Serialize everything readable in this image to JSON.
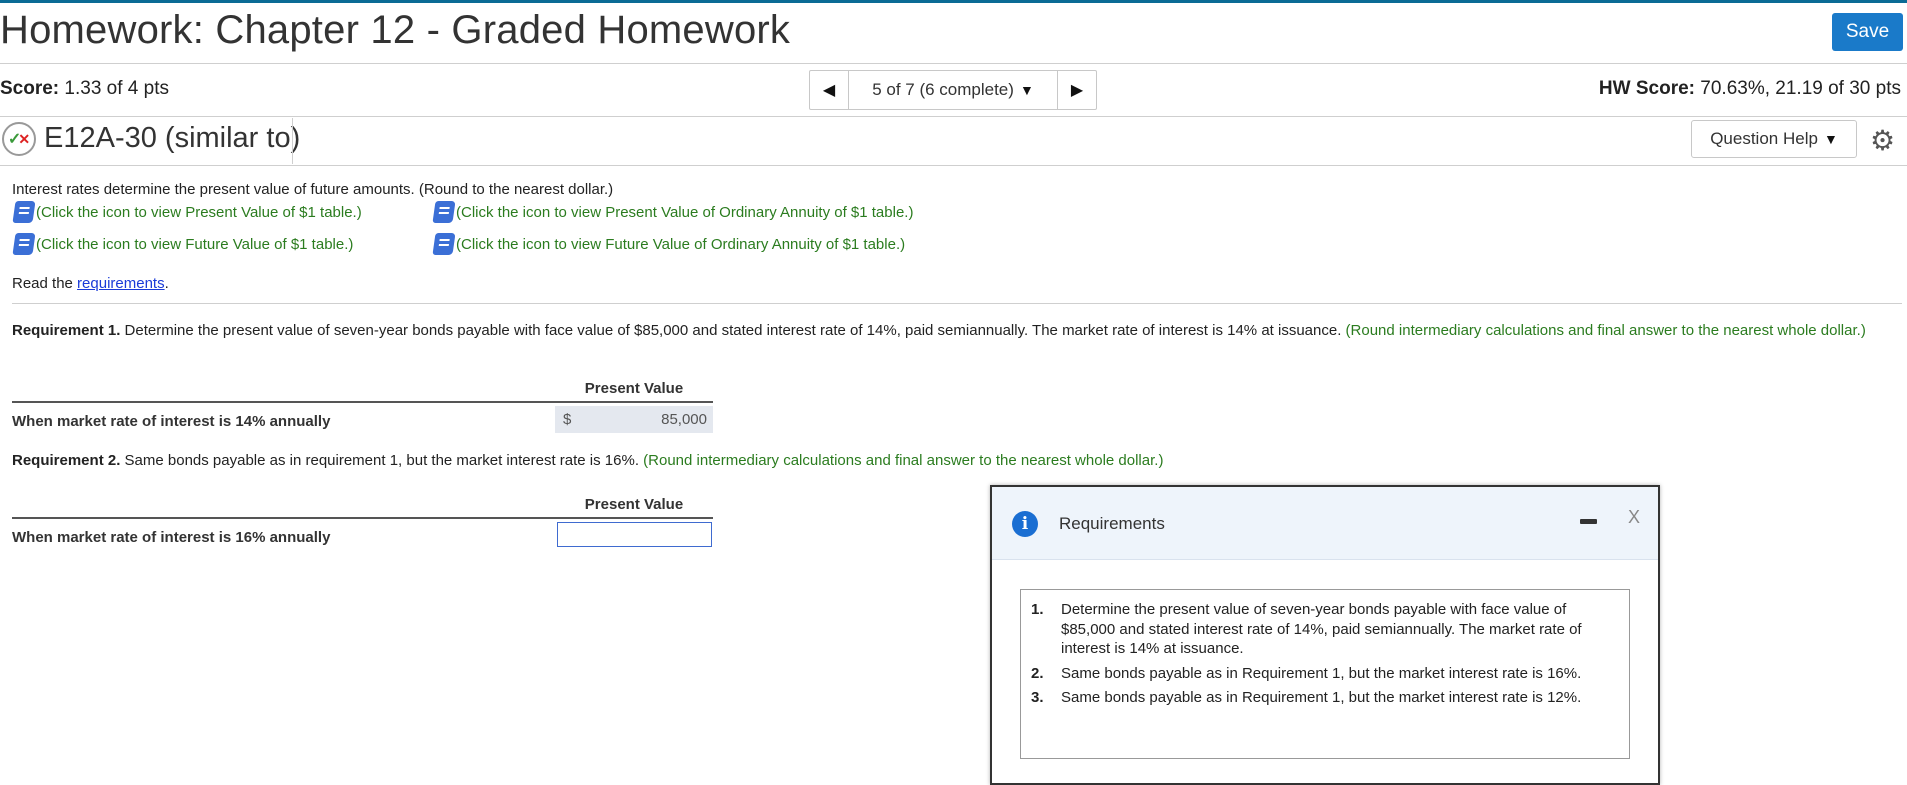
{
  "header": {
    "title": "Homework: Chapter 12 - Graded Homework",
    "save_label": "Save"
  },
  "score": {
    "label": "Score:",
    "value": "1.33 of 4 pts"
  },
  "pager": {
    "status": "5 of 7 (6 complete)"
  },
  "hw_score": {
    "label": "HW Score:",
    "value": "70.63%, 21.19 of 30 pts"
  },
  "question": {
    "id": "E12A-30 (similar to)",
    "help_label": "Question Help"
  },
  "content": {
    "intro": "Interest rates determine the present value of future amounts. (Round to the nearest dollar.)",
    "links": [
      "(Click the icon to view Present Value of $1 table.)",
      "(Click the icon to view Present Value of Ordinary Annuity of $1 table.)",
      "(Click the icon to view Future Value of $1 table.)",
      "(Click the icon to view Future Value of Ordinary Annuity of $1 table.)"
    ],
    "read_prefix": "Read the ",
    "read_link": "requirements",
    "read_suffix": "."
  },
  "requirement1": {
    "label": "Requirement 1.",
    "text": " Determine the present value of seven-year bonds payable with face value of $85,000 and stated interest rate of 14%, paid semiannually. The market rate of interest is 14% at issuance. ",
    "hint": "(Round intermediary calculations and final answer to the nearest whole dollar.)",
    "column_header": "Present Value",
    "row_label": "When market rate of interest is 14% annually",
    "currency": "$",
    "value": "85,000"
  },
  "requirement2": {
    "label": "Requirement 2.",
    "text": " Same bonds payable as in requirement 1, but the market interest rate is 16%. ",
    "hint": "(Round intermediary calculations and final answer to the nearest whole dollar.)",
    "column_header": "Present Value",
    "row_label": "When market rate of interest is 16% annually",
    "input_value": ""
  },
  "popup": {
    "title": "Requirements",
    "close": "X",
    "items": [
      {
        "num": "1.",
        "text": "Determine the present value of seven-year bonds payable with face value of $85,000 and stated interest rate of 14%, paid semiannually. The market rate of interest is 14% at issuance."
      },
      {
        "num": "2.",
        "text": "Same bonds payable as in Requirement 1, but the market interest rate is 16%."
      },
      {
        "num": "3.",
        "text": "Same bonds payable as in Requirement 1, but the market interest rate is 12%."
      }
    ]
  },
  "colors": {
    "accent": "#1a7ac9",
    "hint_green": "#2b7c1f",
    "link_blue": "#1a3bd8"
  }
}
